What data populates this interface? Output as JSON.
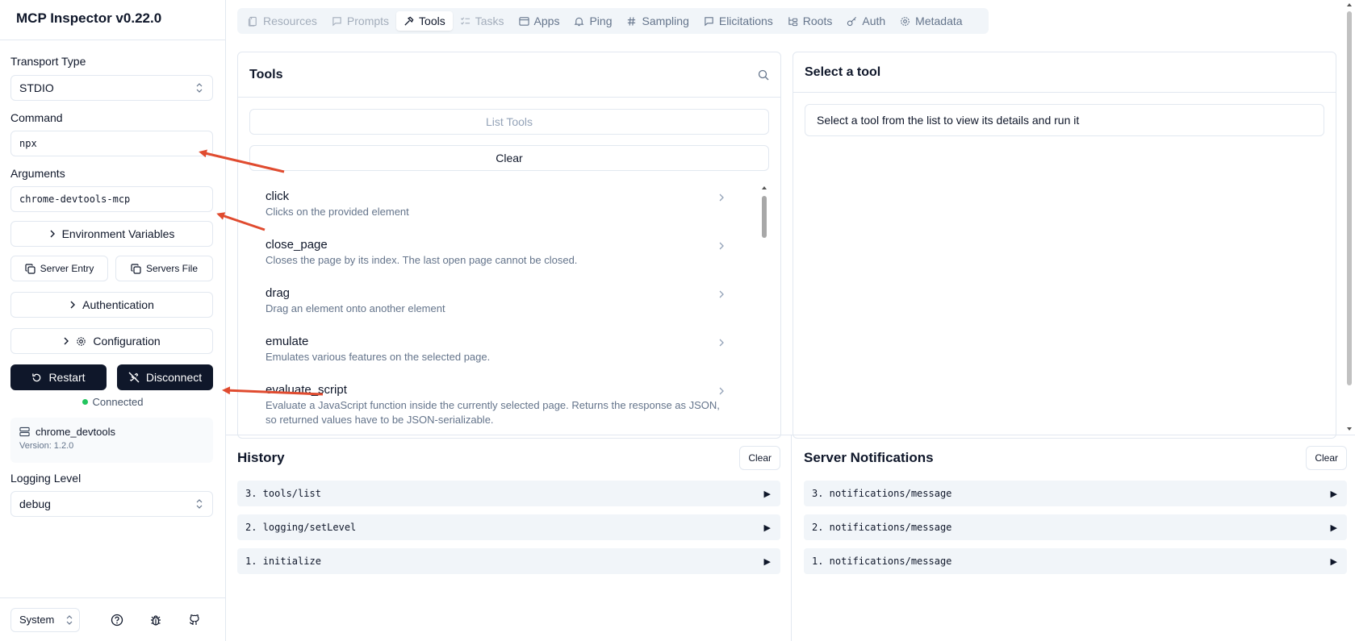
{
  "app": {
    "title": "MCP Inspector v0.22.0"
  },
  "sidebar": {
    "transport": {
      "label": "Transport Type",
      "value": "STDIO"
    },
    "command": {
      "label": "Command",
      "value": "npx"
    },
    "arguments": {
      "label": "Arguments",
      "value": "chrome-devtools-mcp"
    },
    "env_vars": "Environment Variables",
    "server_entry": "Server Entry",
    "servers_file": "Servers File",
    "authentication": "Authentication",
    "configuration": "Configuration",
    "restart": "Restart",
    "disconnect": "Disconnect",
    "status": "Connected",
    "server": {
      "name": "chrome_devtools",
      "version": "Version: 1.2.0"
    },
    "logging": {
      "label": "Logging Level",
      "value": "debug"
    },
    "theme": "System"
  },
  "tabs": [
    {
      "label": "Resources",
      "icon": "file-icon",
      "state": "disabled"
    },
    {
      "label": "Prompts",
      "icon": "message-icon",
      "state": "disabled"
    },
    {
      "label": "Tools",
      "icon": "hammer-icon",
      "state": "active"
    },
    {
      "label": "Tasks",
      "icon": "list-checks-icon",
      "state": "disabled"
    },
    {
      "label": "Apps",
      "icon": "app-window-icon",
      "state": "normal"
    },
    {
      "label": "Ping",
      "icon": "bell-icon",
      "state": "normal"
    },
    {
      "label": "Sampling",
      "icon": "hash-icon",
      "state": "normal"
    },
    {
      "label": "Elicitations",
      "icon": "message-square-icon",
      "state": "normal"
    },
    {
      "label": "Roots",
      "icon": "folder-tree-icon",
      "state": "normal"
    },
    {
      "label": "Auth",
      "icon": "key-icon",
      "state": "normal"
    },
    {
      "label": "Metadata",
      "icon": "settings-icon",
      "state": "normal"
    }
  ],
  "tools_panel": {
    "title": "Tools",
    "list_tools": "List Tools",
    "clear": "Clear",
    "items": [
      {
        "name": "click",
        "desc": "Clicks on the provided element"
      },
      {
        "name": "close_page",
        "desc": "Closes the page by its index. The last open page cannot be closed."
      },
      {
        "name": "drag",
        "desc": "Drag an element onto another element"
      },
      {
        "name": "emulate",
        "desc": "Emulates various features on the selected page."
      },
      {
        "name": "evaluate_script",
        "desc": "Evaluate a JavaScript function inside the currently selected page. Returns the response as JSON, so returned values have to be JSON-serializable."
      }
    ]
  },
  "select_panel": {
    "title": "Select a tool",
    "message": "Select a tool from the list to view its details and run it"
  },
  "history": {
    "title": "History",
    "clear": "Clear",
    "entries": [
      "3. tools/list",
      "2. logging/setLevel",
      "1. initialize"
    ]
  },
  "notifications": {
    "title": "Server Notifications",
    "clear": "Clear",
    "entries": [
      "3. notifications/message",
      "2. notifications/message",
      "1. notifications/message"
    ]
  },
  "colors": {
    "primary": "#0f172a",
    "connected": "#22c55e",
    "annotation_arrow": "#e04b2f"
  }
}
